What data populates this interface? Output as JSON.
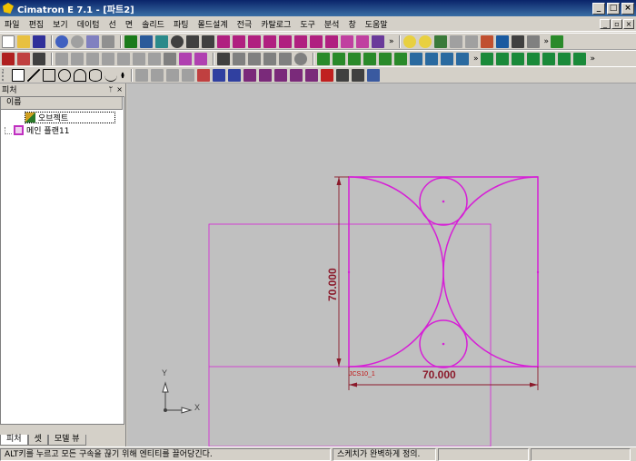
{
  "window": {
    "title": "Cimatron E 7.1 - [파트2]"
  },
  "menubar": {
    "items": [
      "파일",
      "편집",
      "보기",
      "데이텀",
      "선",
      "면",
      "솔리드",
      "파팅",
      "몰드설계",
      "전극",
      "카탈로그",
      "도구",
      "분석",
      "창",
      "도움말"
    ]
  },
  "panel": {
    "title": "피처",
    "column_header": "이름",
    "tree": [
      {
        "label": "오브젝트",
        "icon": "object-icon"
      },
      {
        "label": "메인 플랜11",
        "icon": "plane-icon"
      }
    ],
    "tabs": [
      "피처",
      "셋",
      "모델 뷰"
    ]
  },
  "viewport": {
    "dim_horizontal": "70.000",
    "dim_vertical": "70.000",
    "csys_label": "JCS10_1",
    "axis_x": "X",
    "axis_y": "Y",
    "sketch_color": "#d61fd6",
    "dim_color": "#8b1a2b"
  },
  "status": {
    "hint": "ALT키를 누르고 모든 구속을 끊기 위해 엔티티를 끌어당긴다.",
    "sketch": "스케치가 완벽하게 정의."
  }
}
